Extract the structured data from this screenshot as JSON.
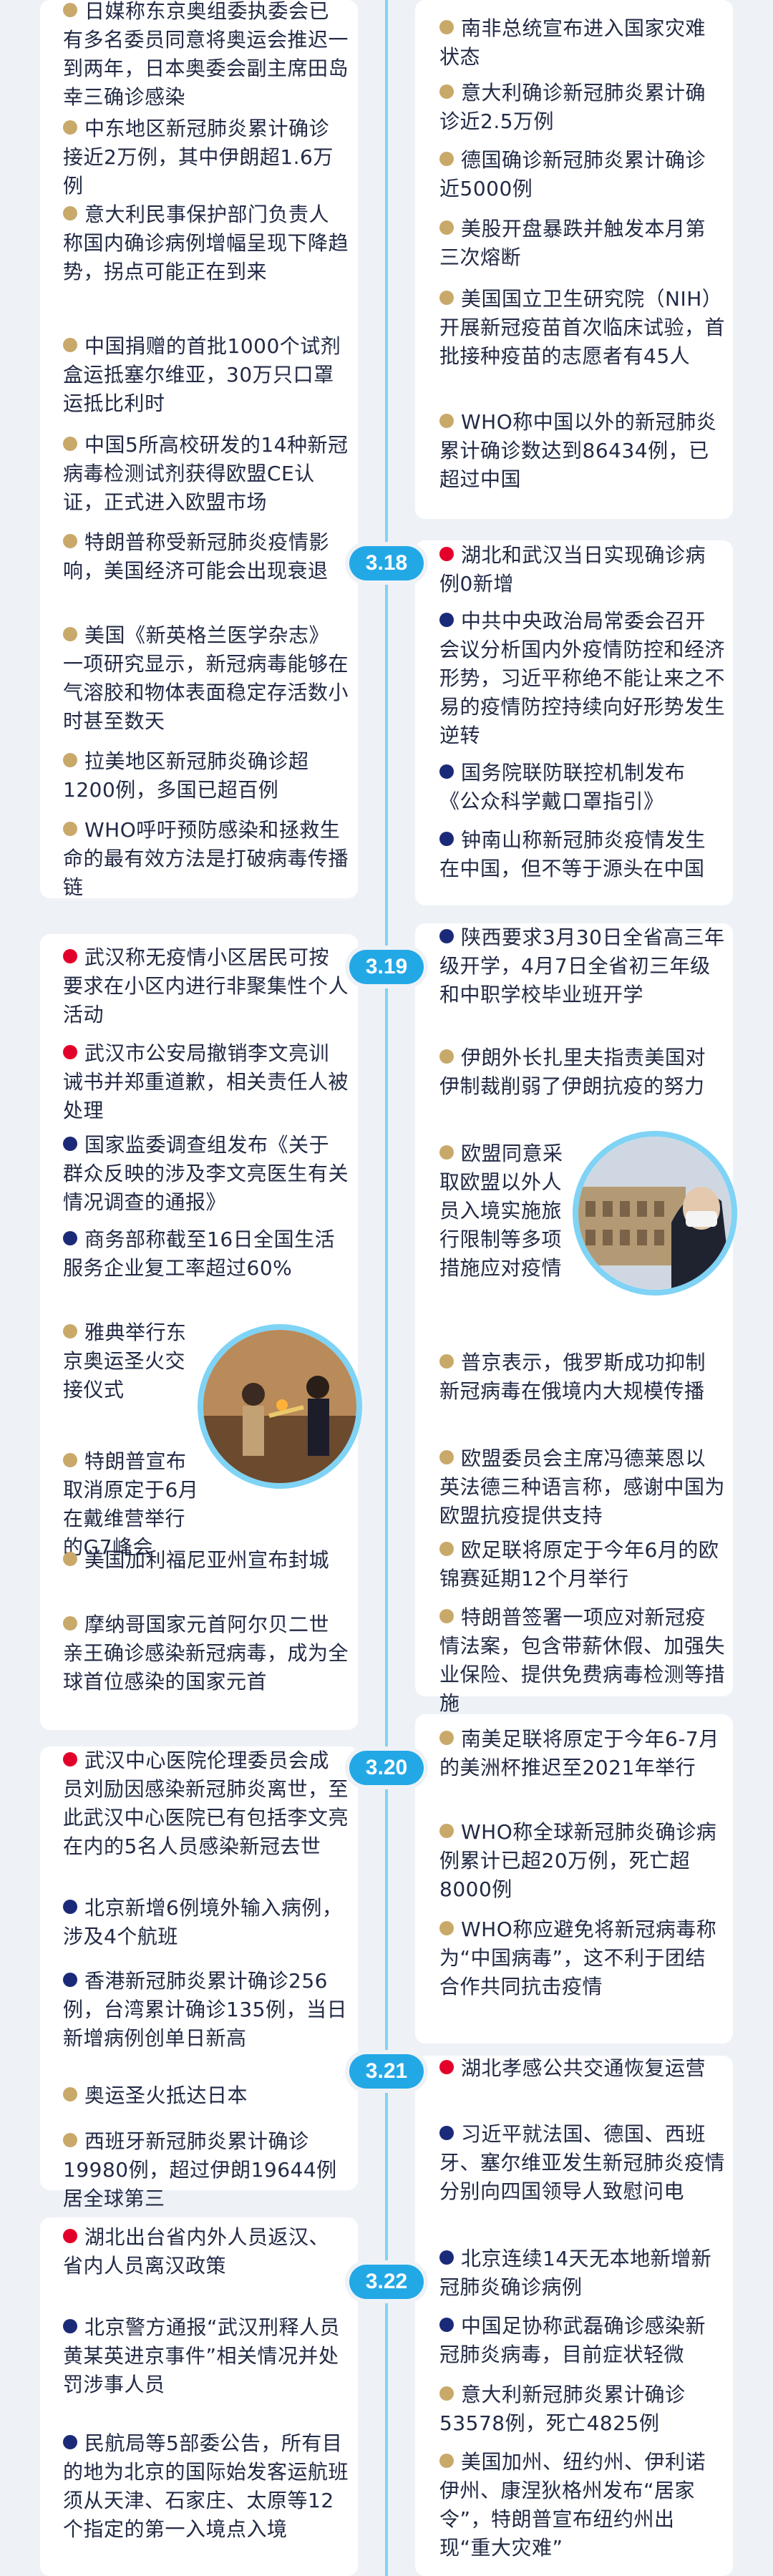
{
  "dates": [
    "3.18",
    "3.19",
    "3.20",
    "3.21",
    "3.22"
  ],
  "left": [
    {
      "dot": "gold",
      "text": "日媒称东京奥组委执委会已有多名委员同意将奥运会推迟一到两年，日本奥委会副主席田岛幸三确诊感染"
    },
    {
      "dot": "gold",
      "text": "中东地区新冠肺炎累计确诊接近2万例，其中伊朗超1.6万例"
    },
    {
      "dot": "gold",
      "text": "意大利民事保护部门负责人称国内确诊病例增幅呈现下降趋势，拐点可能正在到来"
    },
    {
      "dot": "gold",
      "text": "中国捐赠的首批1000个试剂盒运抵塞尔维亚，30万只口罩运抵比利时"
    },
    {
      "dot": "gold",
      "text": "中国5所高校研发的14种新冠病毒检测试剂获得欧盟CE认证，正式进入欧盟市场"
    },
    {
      "dot": "gold",
      "text": "特朗普称受新冠肺炎疫情影响，美国经济可能会出现衰退"
    },
    {
      "dot": "gold",
      "text": "美国《新英格兰医学杂志》一项研究显示，新冠病毒能够在气溶胶和物体表面稳定存活数小时甚至数天"
    },
    {
      "dot": "gold",
      "text": "拉美地区新冠肺炎确诊超1200例，多国已超百例"
    },
    {
      "dot": "gold",
      "text": "WHO呼吁预防感染和拯救生命的最有效方法是打破病毒传播链"
    },
    {
      "dot": "red",
      "text": "武汉称无疫情小区居民可按要求在小区内进行非聚集性个人活动"
    },
    {
      "dot": "red",
      "text": "武汉市公安局撤销李文亮训诫书并郑重道歉，相关责任人被处理"
    },
    {
      "dot": "navy",
      "text": "国家监委调查组发布《关于群众反映的涉及李文亮医生有关情况调查的通报》"
    },
    {
      "dot": "navy",
      "text": "商务部称截至16日全国生活服务企业复工率超过60%"
    },
    {
      "dot": "gold",
      "text": "雅典举行东京奥运圣火交接仪式"
    },
    {
      "dot": "gold",
      "text": "特朗普宣布取消原定于6月在戴维营举行的G7峰会"
    },
    {
      "dot": "gold",
      "text": "美国加利福尼亚州宣布封城"
    },
    {
      "dot": "gold",
      "text": "摩纳哥国家元首阿尔贝二世亲王确诊感染新冠病毒，成为全球首位感染的国家元首"
    },
    {
      "dot": "red",
      "text": "武汉中心医院伦理委员会成员刘励因感染新冠肺炎离世，至此武汉中心医院已有包括李文亮在内的5名人员感染新冠去世"
    },
    {
      "dot": "navy",
      "text": "北京新增6例境外输入病例，涉及4个航班"
    },
    {
      "dot": "navy",
      "text": "香港新冠肺炎累计确诊256例，台湾累计确诊135例，当日新增病例创单日新高"
    },
    {
      "dot": "gold",
      "text": "奥运圣火抵达日本"
    },
    {
      "dot": "gold",
      "text": "西班牙新冠肺炎累计确诊19980例，超过伊朗19644例居全球第三"
    },
    {
      "dot": "red",
      "text": "湖北出台省内外人员返汉、省内人员离汉政策"
    },
    {
      "dot": "navy",
      "text": "北京警方通报“武汉刑释人员黄某英进京事件”相关情况并处罚涉事人员"
    },
    {
      "dot": "navy",
      "text": "民航局等5部委公告，所有目的地为北京的国际始发客运航班须从天津、石家庄、太原等12个指定的第一入境点入境"
    }
  ],
  "right": [
    {
      "dot": "gold",
      "text": "南非总统宣布进入国家灾难状态"
    },
    {
      "dot": "gold",
      "text": "意大利确诊新冠肺炎累计确诊近2.5万例"
    },
    {
      "dot": "gold",
      "text": "德国确诊新冠肺炎累计确诊近5000例"
    },
    {
      "dot": "gold",
      "text": "美股开盘暴跌并触发本月第三次熔断"
    },
    {
      "dot": "gold",
      "text": "美国国立卫生研究院（NIH）开展新冠疫苗首次临床试验，首批接种疫苗的志愿者有45人"
    },
    {
      "dot": "gold",
      "text": "WHO称中国以外的新冠肺炎累计确诊数达到86434例，已超过中国"
    },
    {
      "dot": "red",
      "text": "湖北和武汉当日实现确诊病例0新增"
    },
    {
      "dot": "navy",
      "text": "中共中央政治局常委会召开会议分析国内外疫情防控和经济形势，习近平称绝不能让来之不易的疫情防控持续向好形势发生逆转"
    },
    {
      "dot": "navy",
      "text": "国务院联防联控机制发布《公众科学戴口罩指引》"
    },
    {
      "dot": "navy",
      "text": "钟南山称新冠肺炎疫情发生在中国，但不等于源头在中国"
    },
    {
      "dot": "navy",
      "text": "陕西要求3月30日全省高三年级开学，4月7日全省初三年级和中职学校毕业班开学"
    },
    {
      "dot": "gold",
      "text": "伊朗外长扎里夫指责美国对伊制裁削弱了伊朗抗疫的努力"
    },
    {
      "dot": "gold",
      "text": "欧盟同意采取欧盟以外人员入境实施旅行限制等多项措施应对疫情"
    },
    {
      "dot": "gold",
      "text": "普京表示，俄罗斯成功抑制新冠病毒在俄境内大规模传播"
    },
    {
      "dot": "gold",
      "text": "欧盟委员会主席冯德莱恩以英法德三种语言称，感谢中国为欧盟抗疫提供支持"
    },
    {
      "dot": "gold",
      "text": "欧足联将原定于今年6月的欧锦赛延期12个月举行"
    },
    {
      "dot": "gold",
      "text": "特朗普签署一项应对新冠疫情法案，包含带薪休假、加强失业保险、提供免费病毒检测等措施"
    },
    {
      "dot": "gold",
      "text": "南美足联将原定于今年6-7月的美洲杯推迟至2021年举行"
    },
    {
      "dot": "gold",
      "text": "WHO称全球新冠肺炎确诊病例累计已超20万例，死亡超8000例"
    },
    {
      "dot": "gold",
      "text": "WHO称应避免将新冠病毒称为“中国病毒”，这不利于团结合作共同抗击疫情"
    },
    {
      "dot": "red",
      "text": "湖北孝感公共交通恢复运营"
    },
    {
      "dot": "navy",
      "text": "习近平就法国、德国、西班牙、塞尔维亚发生新冠肺炎疫情分别向四国领导人致慰问电"
    },
    {
      "dot": "navy",
      "text": "北京连续14天无本地新增新冠肺炎确诊病例"
    },
    {
      "dot": "navy",
      "text": "中国足协称武磊确诊感染新冠肺炎病毒，目前症状轻微"
    },
    {
      "dot": "gold",
      "text": "意大利新冠肺炎累计确诊53578例，死亡4825例"
    },
    {
      "dot": "gold",
      "text": "美国加州、纽约州、伊利诺伊州、康涅狄格州发布“居家令”，特朗普宣布纽约州出现“重大灾难”"
    }
  ]
}
